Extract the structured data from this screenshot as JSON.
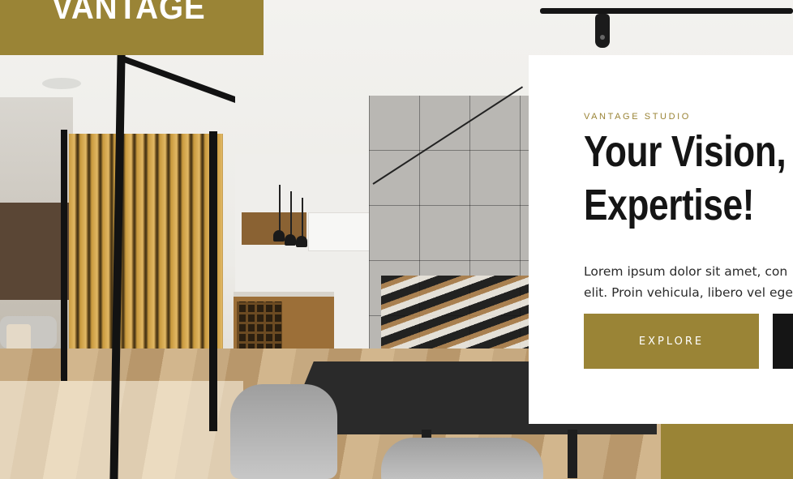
{
  "brand": {
    "logo_text": "VANTAGE",
    "accent_color": "#9a8436",
    "dark_color": "#151515"
  },
  "hero": {
    "eyebrow": "VANTAGE STUDIO",
    "headline_line1": "Your Vision, O",
    "headline_line2": "Expertise!",
    "body_line1": "Lorem ipsum dolor sit amet, con",
    "body_line2": "elit. Proin vehicula, libero vel ege",
    "primary_button_label": "EXPLORE",
    "secondary_button_label": ""
  },
  "background": {
    "icon": "interior-photo"
  }
}
